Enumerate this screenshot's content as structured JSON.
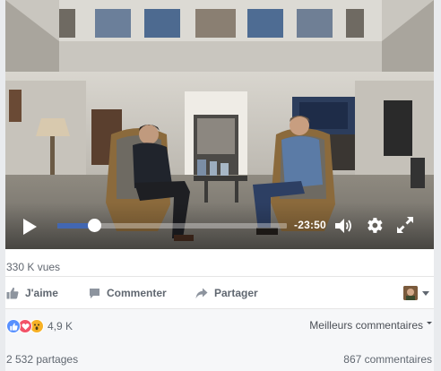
{
  "video": {
    "time_remaining": "-23:50",
    "progress_fraction": 0.16
  },
  "post": {
    "views": "330 K vues",
    "actions": {
      "like": "J'aime",
      "comment": "Commenter",
      "share": "Partager"
    },
    "reactions_count": "4,9 K",
    "sort_label": "Meilleurs commentaires",
    "shares": "2 532 partages",
    "comments": "867 commentaires"
  },
  "colors": {
    "accent": "#4267b2",
    "like_blue": "#5890ff",
    "love_red": "#f25268",
    "wow_yellow": "#f7b125"
  },
  "icons": {
    "play": "play-icon",
    "volume": "volume-icon",
    "settings": "gear-icon",
    "fullscreen": "fullscreen-icon",
    "like": "thumbs-up-icon",
    "comment": "speech-bubble-icon",
    "share": "share-arrow-icon"
  }
}
